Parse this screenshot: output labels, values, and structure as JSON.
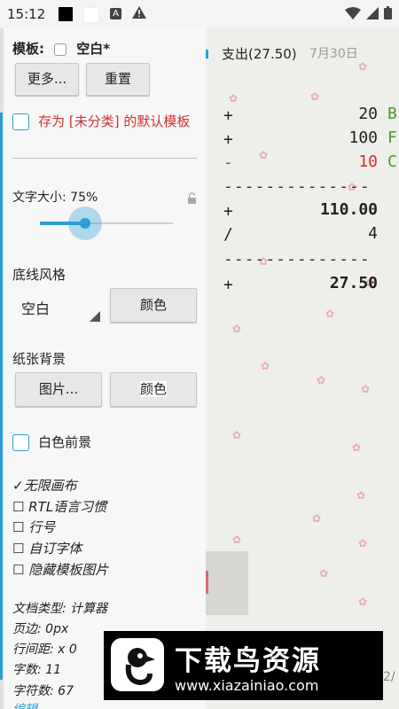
{
  "status_bar": {
    "time": "15:12"
  },
  "panel": {
    "template_label": "模板:",
    "template_value": "空白*",
    "more_button": "更多...",
    "reset_button": "重置",
    "save_default_label": "存为 [未分类] 的默认模板",
    "font_size_label": "文字大小: 75%",
    "font_size_value": 0.33,
    "underline_label": "底线风格",
    "underline_value": "空白",
    "underline_color_button": "颜色",
    "paper_label": "纸张背景",
    "paper_image_button": "图片...",
    "paper_color_button": "颜色",
    "white_fg_label": "白色前景",
    "options": [
      {
        "mark": "✓",
        "label": "无限画布"
      },
      {
        "mark": "☐",
        "label": "RTL语言习惯"
      },
      {
        "mark": "☐",
        "label": "行号"
      },
      {
        "mark": "☐",
        "label": "自订字体"
      },
      {
        "mark": "☐",
        "label": "隐藏模板图片"
      }
    ],
    "info": {
      "doc_type": "文档类型: 计算器",
      "margin": "页边: 0px",
      "line_spacing": "行间距: x 0",
      "word_count": "字数: 11",
      "char_count": "字符数: 67",
      "edit": "编辑"
    }
  },
  "document": {
    "title": "支出(27.50)",
    "date": "7月30日",
    "lines": [
      {
        "op": "+",
        "value": "20",
        "tag": "B",
        "op_color": "#222222",
        "value_color": "#222222",
        "tag_color": "#4a9a2a",
        "bold": false
      },
      {
        "op": "+",
        "value": "100",
        "tag": "F",
        "op_color": "#222222",
        "value_color": "#222222",
        "tag_color": "#4a9a2a",
        "bold": false
      },
      {
        "op": "-",
        "value": "10",
        "tag": "C",
        "op_color": "#d03030",
        "value_color": "#d03030",
        "tag_color": "#4a9a2a",
        "bold": false
      }
    ],
    "dash_line": "--------------",
    "subtotal_op": "+",
    "subtotal": "110.00",
    "divide_op": "/",
    "divisor": "4",
    "result_op": "+",
    "result": "27.50",
    "page_hint": "2/"
  },
  "watermark": {
    "title": "下载鸟资源",
    "url": "www.xiazainiao.com"
  },
  "colors": {
    "accent": "#2a9fd6",
    "red": "#d03030",
    "green": "#4a9a2a"
  }
}
